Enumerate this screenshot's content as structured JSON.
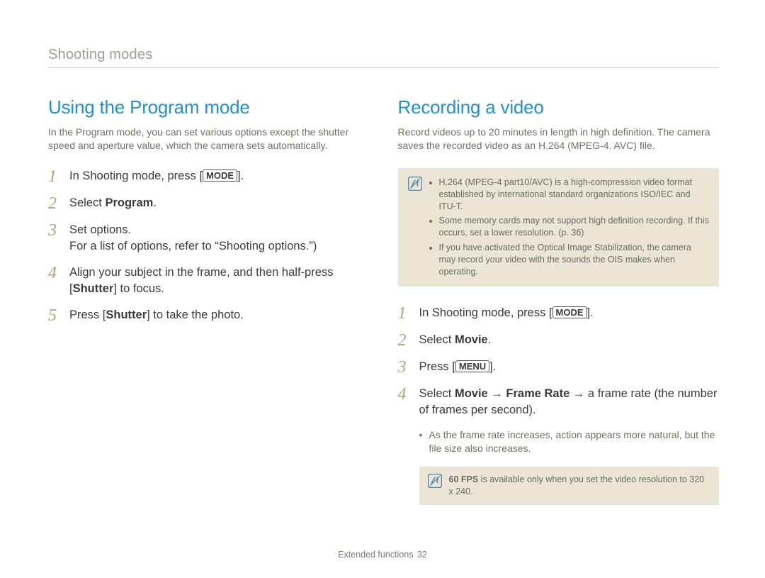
{
  "section_title": "Shooting modes",
  "left": {
    "heading": "Using the Program mode",
    "intro": "In the Program mode, you can set various options except the shutter speed and aperture value, which the camera sets automatically.",
    "steps": [
      {
        "n": "1",
        "a": "In Shooting mode, press [",
        "btn": "MODE",
        "b": "]."
      },
      {
        "n": "2",
        "a": "Select ",
        "bold": "Program",
        "b": "."
      },
      {
        "n": "3",
        "a": "Set options.",
        "line2": "For a list of options, refer to “Shooting options.”)"
      },
      {
        "n": "4",
        "a": "Align your subject in the frame, and then half-press [",
        "bold": "Shutter",
        "b": "] to focus."
      },
      {
        "n": "5",
        "a": "Press [",
        "bold": "Shutter",
        "b": "] to take the photo."
      }
    ]
  },
  "right": {
    "heading": "Recording a video",
    "intro": "Record videos up to 20 minutes in length in high definition. The camera saves the recorded video as an H.264 (MPEG-4. AVC) file.",
    "note1": [
      "H.264 (MPEG-4 part10/AVC) is a high-compression video format established by international standard organizations ISO/IEC and ITU-T.",
      "Some memory cards may not support high definition recording. If this occurs, set a lower resolution. (p. 36)",
      "If you have activated the Optical Image Stabilization, the camera may record your video with the sounds the OIS makes when operating."
    ],
    "steps": [
      {
        "n": "1",
        "a": "In Shooting mode, press [",
        "btn": "MODE",
        "b": "]."
      },
      {
        "n": "2",
        "a": "Select ",
        "bold": "Movie",
        "b": "."
      },
      {
        "n": "3",
        "a": "Press [",
        "btn": "MENU",
        "b": "]."
      },
      {
        "n": "4",
        "a": "Select ",
        "bold": "Movie",
        "mid": " → ",
        "bold2": "Frame Rate",
        "b": " → a frame rate (the number of frames per second)."
      }
    ],
    "sub_bullet": "As the frame rate increases, action appears more natural, but the file size also increases.",
    "note2_bold": "60 FPS",
    "note2_rest": " is available only when you set the video resolution to 320 x 240."
  },
  "footer_label": "Extended functions",
  "footer_page": "32"
}
